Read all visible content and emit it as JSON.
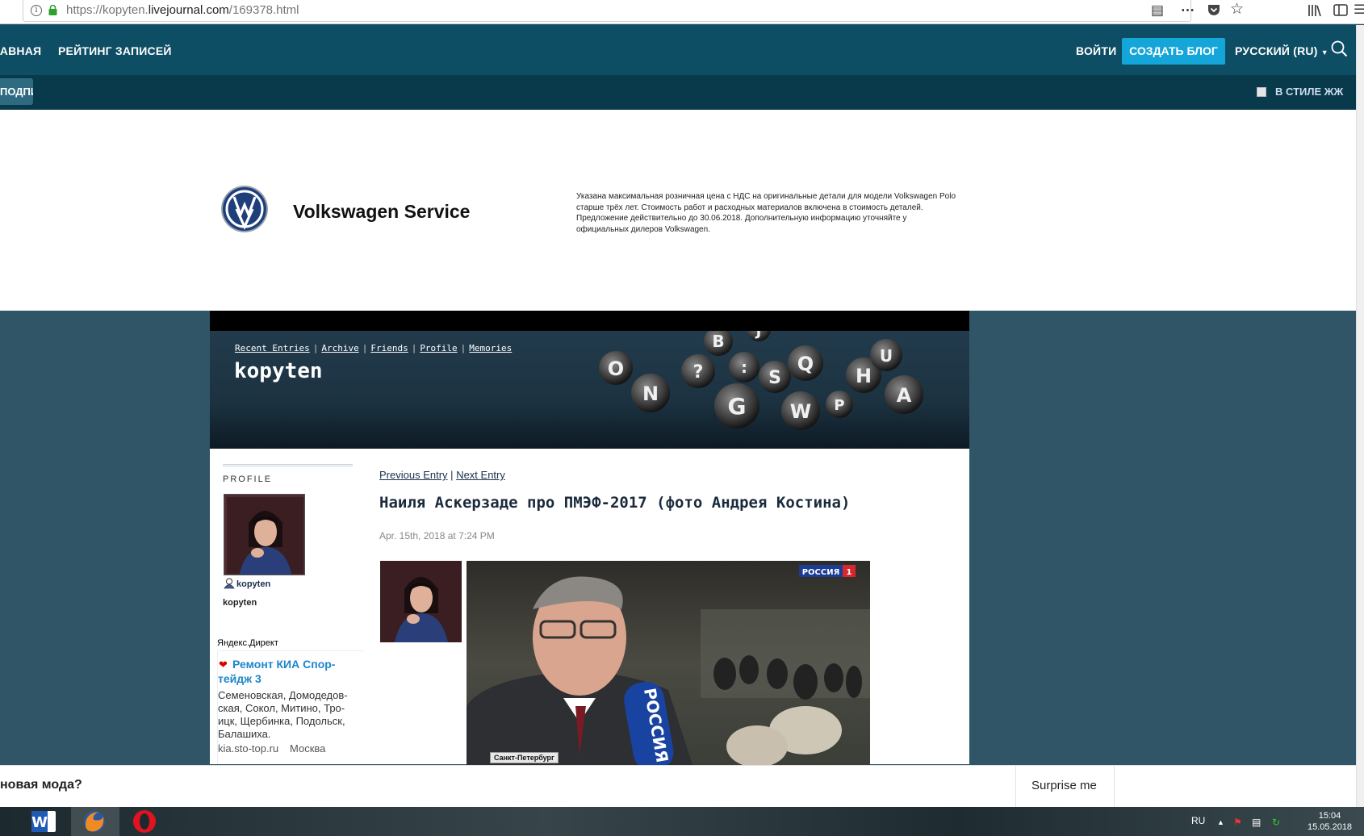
{
  "browser": {
    "url_prefix": "https://kopyten.",
    "url_domain": "livejournal.com",
    "url_path": "/169378.html",
    "icons": [
      "info-icon",
      "lock-icon",
      "reader-icon",
      "more-icon",
      "pocket-icon",
      "bookmark-star-icon",
      "library-icon",
      "sidebar-icon",
      "menu-icon"
    ]
  },
  "lj_nav": {
    "main": "ГЛАВНАЯ",
    "rating": "РЕЙТИНГ ЗАПИСЕЙ",
    "login": "ВОЙТИ",
    "create_blog": "СОЗДАТЬ БЛОГ",
    "language": "РУССКИЙ (RU)",
    "second_btn": "ПОДПИСАТЬСЯ",
    "lj_style": "В СТИЛЕ ЖЖ"
  },
  "ad": {
    "title": "Volkswagen Service",
    "text": "Указана максимальная розничная цена с НДС на оригинальные детали для модели Volkswagen Polo старше трёх лет. Стоимость работ и расходных материалов включена в стоимость деталей. Предложение действительно до 30.06.2018. Дополнительную информацию уточняйте у официальных дилеров Volkswagen."
  },
  "blog": {
    "nav": [
      "Recent Entries",
      "Archive",
      "Friends",
      "Profile",
      "Memories"
    ],
    "title": "kopyten",
    "keys": [
      "O",
      "N",
      "?",
      "B",
      ":",
      "J",
      "G",
      "S",
      "Q",
      "W",
      "P",
      "H",
      "U",
      "A"
    ]
  },
  "sidebar": {
    "profile_heading": "PROFILE",
    "username": "kopyten",
    "name": "kopyten",
    "ad_heading": "Яндекс.Директ",
    "ad_title": "Ремонт КИА Спор-тейдж 3",
    "ad_desc": "Семеновская, Домодедов-ская, Сокол, Митино, Тро-ицк, Щербинка, Подольск, Балашиха.",
    "ad_url": "kia.sto-top.ru",
    "ad_city": "Москва"
  },
  "entry": {
    "prev": "Previous Entry",
    "sep": "|",
    "next": "Next Entry",
    "title": "Наиля Аскерзаде про ПМЭФ-2017 (фото Андрея Костина)",
    "date": "Apr. 15th, 2018 at 7:24 PM",
    "photo_badge": "РОССИЯ",
    "photo_badge_num": "1",
    "photo_location": "Санкт-Петербург",
    "mic_text": "РОССИЯ"
  },
  "bottom": {
    "question": "новая мода?",
    "surprise": "Surprise me"
  },
  "taskbar": {
    "lang": "RU",
    "time": "15:04",
    "date": "15.05.2018"
  },
  "colors": {
    "nav1": "#0e4e64",
    "nav2": "#093a4c",
    "accent": "#14a6d9",
    "page_bg": "#2f5567"
  }
}
